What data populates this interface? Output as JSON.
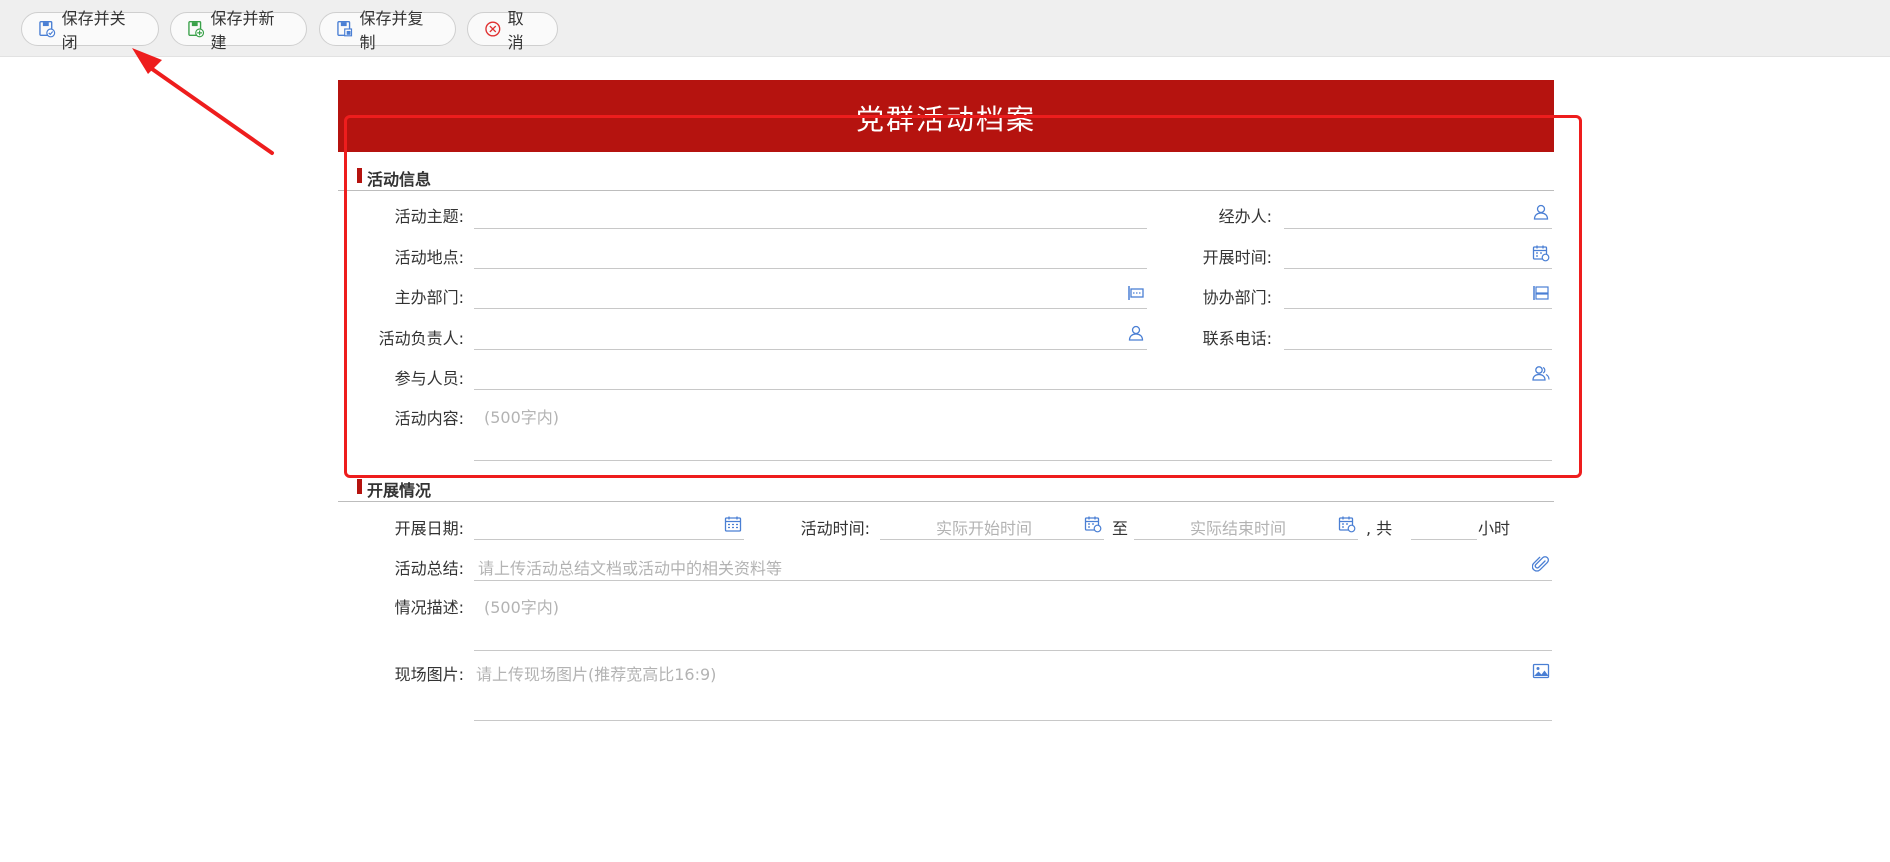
{
  "toolbar": {
    "save_close": "保存并关闭",
    "save_new": "保存并新建",
    "save_copy": "保存并复制",
    "cancel": "取消"
  },
  "form": {
    "title": "党群活动档案",
    "number_label": "№"
  },
  "section1": {
    "title": "活动信息",
    "topic": "活动主题:",
    "handler": "经办人:",
    "location": "活动地点:",
    "start_time": "开展时间:",
    "host_dept": "主办部门:",
    "co_dept": "协办部门:",
    "leader": "活动负责人:",
    "phone": "联系电话:",
    "participants": "参与人员:",
    "content": "活动内容:",
    "content_placeholder": "(500字内)"
  },
  "section2": {
    "title": "开展情况",
    "date": "开展日期:",
    "activity_time": "活动时间:",
    "start_placeholder": "实际开始时间",
    "to": "至",
    "end_placeholder": "实际结束时间",
    "total": ", 共",
    "hours": "小时",
    "summary": "活动总结:",
    "summary_placeholder": "请上传活动总结文档或活动中的相关资料等",
    "description": "情况描述:",
    "description_placeholder": "(500字内)",
    "photos": "现场图片:",
    "photos_placeholder": "请上传现场图片(推荐宽高比16:9)"
  },
  "colors": {
    "brand_red": "#b5130f",
    "icon_blue": "#4a7fd4",
    "highlight": "#ee1d1d"
  }
}
